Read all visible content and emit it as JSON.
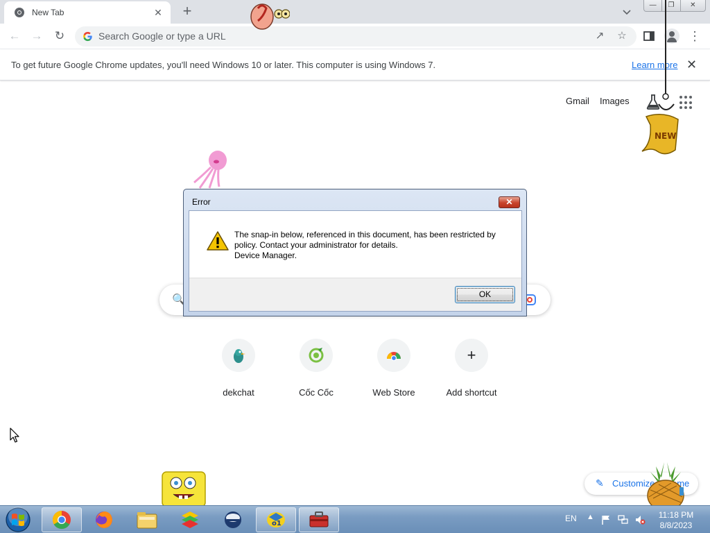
{
  "browser": {
    "tab_title": "New Tab",
    "tab_close": "✕",
    "new_tab": "+",
    "omnibox_placeholder": "Search Google or type a URL",
    "window_controls": {
      "minimize": "—",
      "restore": "❐",
      "close": "✕"
    }
  },
  "infobar": {
    "message": "To get future Google Chrome updates, you'll need Windows 10 or later. This computer is using Windows 7.",
    "link": "Learn more",
    "close": "✕"
  },
  "ntp": {
    "links": {
      "gmail": "Gmail",
      "images": "Images"
    },
    "shortcuts": [
      {
        "label": "dekchat",
        "icon": "dekchat-icon"
      },
      {
        "label": "Cốc Cốc",
        "icon": "coccoc-icon"
      },
      {
        "label": "Web Store",
        "icon": "webstore-icon"
      },
      {
        "label": "Add shortcut",
        "icon": "plus-icon"
      }
    ],
    "add_symbol": "+",
    "customize_label": "Customize Chrome"
  },
  "dialog": {
    "title": "Error",
    "close": "✕",
    "message_line1": "The snap-in below, referenced in this document, has been restricted by",
    "message_line2": "policy. Contact your administrator for details.",
    "message_line3": "Device Manager.",
    "ok_label": "OK"
  },
  "taskbar": {
    "language": "EN",
    "time": "11:18 PM",
    "date": "8/8/2023",
    "apps": [
      "chrome-icon",
      "firefox-icon",
      "file-explorer-icon",
      "bluestacks-icon",
      "network-app-icon",
      "app-icon",
      "toolbox-icon"
    ]
  },
  "pets": [
    "sea-pet-icon",
    "jellyfish-icon",
    "new-badge-icon",
    "spongebob-icon",
    "pineapple-icon"
  ],
  "colors": {
    "accent": "#1a73e8",
    "tabstrip": "#dee1e6",
    "taskbar": "#7a9cc2",
    "dialog_close": "#c8442c"
  }
}
